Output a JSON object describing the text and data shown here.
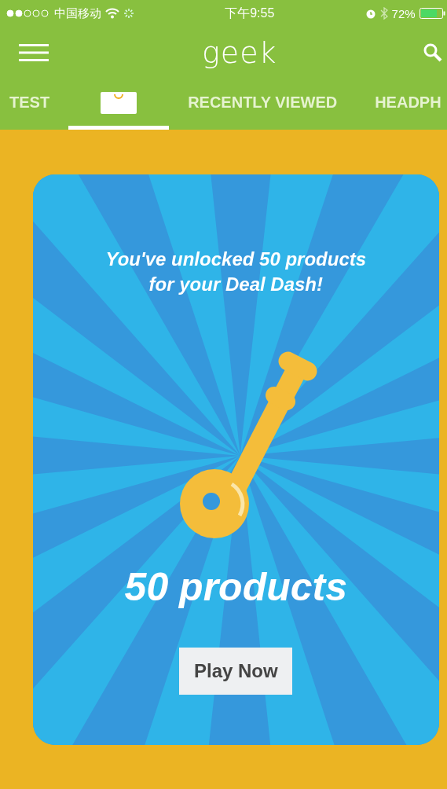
{
  "status_bar": {
    "carrier": "中国移动",
    "time": "下午9:55",
    "battery": "72%"
  },
  "toolbar": {
    "title": "geek"
  },
  "tabs": [
    {
      "kind": "text",
      "label": "TEST",
      "selected": false
    },
    {
      "kind": "bag",
      "selected": true
    },
    {
      "kind": "text",
      "label": "RECENTLY VIEWED",
      "selected": false
    },
    {
      "kind": "text",
      "label": "HEADPH",
      "selected": false
    }
  ],
  "card": {
    "message": "You've unlocked 50 products for your Deal Dash!",
    "headline": "50 products",
    "button": "Play Now"
  }
}
